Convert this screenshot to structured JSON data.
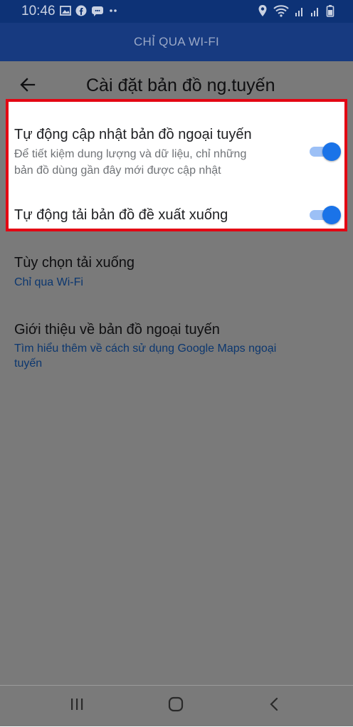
{
  "status_bar": {
    "time": "10:46",
    "left_icons": [
      "image-icon",
      "facebook-icon",
      "messenger-icon",
      "more-dots-icon"
    ],
    "right_icons": [
      "location-icon",
      "wifi-icon",
      "signal-icon",
      "signal-icon",
      "battery-icon"
    ]
  },
  "app_bar": {
    "title": "CHỈ QUA WI-FI"
  },
  "toolbar": {
    "title": "Cài đặt bản đồ ng.tuyến",
    "back_icon": "arrow-back-icon"
  },
  "settings": {
    "auto_update": {
      "title": "Tự động cập nhật bản đồ ngoại tuyến",
      "subtitle_line1": "Để tiết kiệm dung lượng và dữ liệu, chỉ những",
      "subtitle_line2": "bản đồ dùng gần đây mới được cập nhật",
      "enabled": true
    },
    "auto_download": {
      "title": "Tự động tải bản đồ đề xuất xuống",
      "enabled": true
    },
    "download_preference": {
      "title": "Tùy chọn tải xuống",
      "value": "Chỉ qua Wi-Fi"
    },
    "about": {
      "title": "Giới thiệu về bản đồ ngoại tuyến",
      "link_line1": "Tìm hiểu thêm về cách sử dụng Google Maps ngoại",
      "link_line2": "tuyến"
    }
  },
  "colors": {
    "accent": "#1a73e8",
    "highlight_border": "#e30613",
    "app_bar": "#173a80",
    "status_bar": "#0d3276"
  },
  "nav_bar": {
    "buttons": [
      "recents-icon",
      "home-icon",
      "back-icon"
    ]
  }
}
